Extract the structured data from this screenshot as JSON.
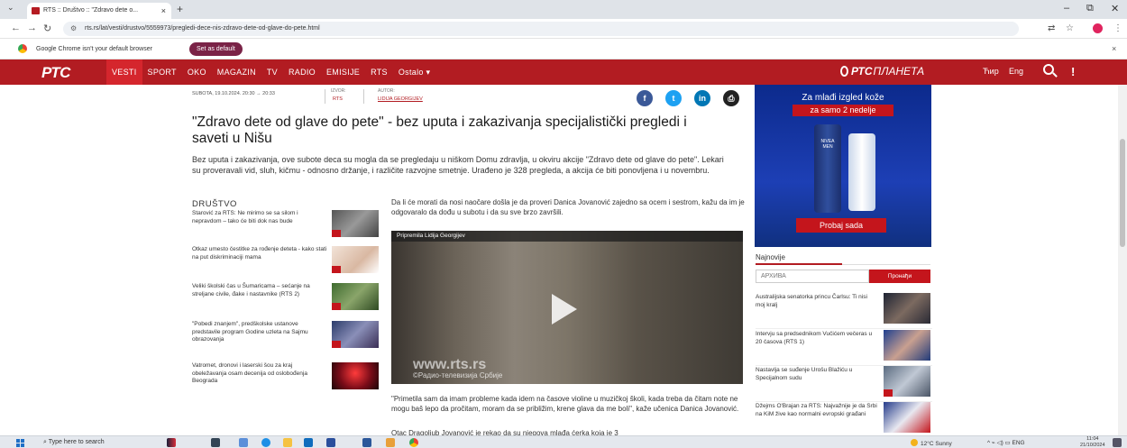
{
  "browser": {
    "tab_title": "RTS :: Društvo :: \"Zdravo dete o...",
    "tab_close": "×",
    "new_tab": "+",
    "url": "rts.rs/lat/vesti/drustvo/5559973/pregledi-dece-nis-zdravo-dete-od-glave-do-pete.html",
    "infobar_text": "Google Chrome isn't your default browser",
    "set_default_label": "Set as default",
    "infobar_close": "×"
  },
  "site": {
    "logo": "РТС",
    "nav": [
      "VESTI",
      "SPORT",
      "OKO",
      "MAGAZIN",
      "TV",
      "RADIO",
      "EMISIJE",
      "RTS",
      "Ostalo ▾"
    ],
    "planeta_brand": "РТС",
    "planeta_text": "ПЛАНЕТА",
    "script_cyr": "Ћир",
    "lang_eng": "Eng"
  },
  "article": {
    "date": "SUBOTA, 19.10.2024. 20:30 → 20:33",
    "source_label": "IZVOR:",
    "source": "RTS",
    "author_label": "AUTOR:",
    "author": "LIDIJA GEORGIJEV",
    "title": "\"Zdravo dete od glave do pete\" - bez uputa i zakazivanja specijalistički pregledi i saveti u Nišu",
    "lead": "Bez uputa i zakazivanja, ove subote deca su mogla da se pregledaju u niškom Domu zdravlja, u okviru akcije \"Zdravo dete od glave do pete\". Lekari su proveravali vid, sluh, kičmu - odnosno držanje, i različite razvojne smetnje. Urađeno je 328 pregleda, a akcija će biti ponovljena i u novembru.",
    "section": "DRUŠTVO",
    "body1": "Da li će morati da nosi naočare došla je da proveri Danica Jovanović zajedno sa ocem i sestrom, kažu da im je odgovaralo da dođu u subotu i da su sve brzo završili.",
    "video_label": "Pripremila Lidija Georgijev",
    "video_wm1": "www.rts.rs",
    "video_wm2": "©Радио-телевизија Србије",
    "body2": "\"Primetila sam da imam probleme kada idem na časove violine u muzičkoj školi, kada treba da čitam note ne mogu baš lepo da pročitam, moram da se približim, krene glava da me boli\", kaže učenica Danica Jovanović.",
    "body3": "Otac Dragoljub Jovanović je rekao da su njegova mlađa ćerka koja je 3"
  },
  "related": [
    {
      "text": "Starović za RTS: Ne mirimo se sa silom i nepravdom – tako će biti dok nas bude"
    },
    {
      "text": "Otkaz umesto čestitke za rođenje deteta - kako stati na put diskriminaciji mama"
    },
    {
      "text": "Veliki školski čas u Šumaricama – sećanje na streljane civile, đake i nastavnike (RTS 2)"
    },
    {
      "text": "\"Pobedi znanjem\", predškolske ustanove predstavile program Godine uzleta na Sajmu obrazovanja"
    },
    {
      "text": "Vatromet, dronovi i laserski šou za kraj obeležavanja osam decenija od oslobođenja Beograda"
    }
  ],
  "ad": {
    "line1": "Za mlađi izgled kože",
    "line2": "za samo 2 nedelje",
    "brand": "NIVEA MEN",
    "button": "Probaj sada"
  },
  "sidebar": {
    "latest_label": "Najnovije",
    "archive_placeholder": "АРХИВА",
    "search_button": "Пронађи",
    "news": [
      {
        "text": "Australijska senatorka princu Čarlsu: Ti nisi moj kralj"
      },
      {
        "text": "Intervju sa predsednikom Vučićem večeras u 20 časova (RTS 1)"
      },
      {
        "text": "Nastavlja se suđenje Urošu Blažiću u Specijalnom sudu"
      },
      {
        "text": "Džejms O'Brajan za RTS: Najvažnije je da Srbi na KiM žive kao normalni evropski građani"
      }
    ]
  },
  "taskbar": {
    "search_placeholder": "Type here to search",
    "weather": "12°C  Sunny",
    "tray": "^  ⌁  ◁)  ▭  ENG",
    "time": "11:04",
    "date": "21/10/2024"
  },
  "colors": {
    "accent": "#b21c22",
    "button_red": "#c4151c",
    "ad_blue": "#1d3fb5"
  }
}
